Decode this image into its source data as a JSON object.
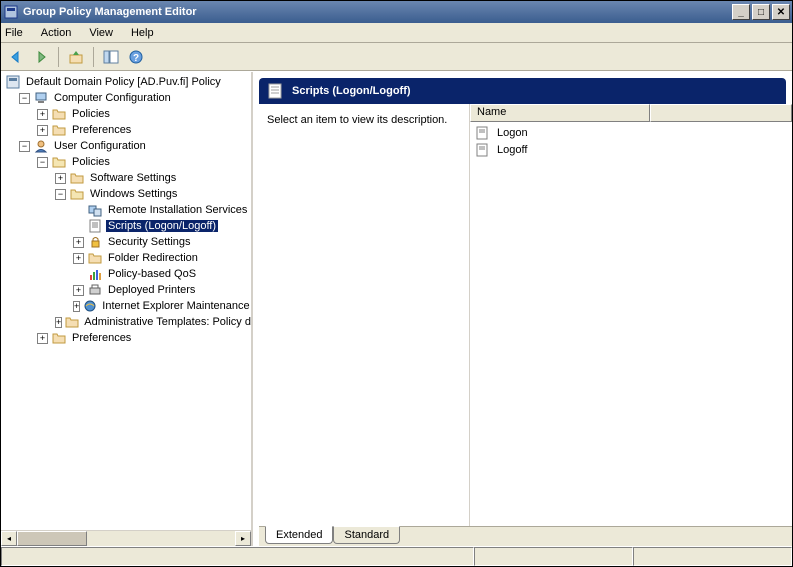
{
  "window": {
    "title": "Group Policy Management Editor"
  },
  "menu": {
    "file": "File",
    "action": "Action",
    "view": "View",
    "help": "Help"
  },
  "tree": {
    "root": "Default Domain Policy [AD.Puv.fi] Policy",
    "computer_config": "Computer Configuration",
    "cc_policies": "Policies",
    "cc_preferences": "Preferences",
    "user_config": "User Configuration",
    "uc_policies": "Policies",
    "software_settings": "Software Settings",
    "windows_settings": "Windows Settings",
    "remote_install": "Remote Installation Services",
    "scripts": "Scripts (Logon/Logoff)",
    "security_settings": "Security Settings",
    "folder_redirection": "Folder Redirection",
    "policy_qos": "Policy-based QoS",
    "deployed_printers": "Deployed Printers",
    "ie_maintenance": "Internet Explorer Maintenance",
    "admin_templates": "Administrative Templates: Policy definitions",
    "uc_preferences": "Preferences"
  },
  "details": {
    "header": "Scripts (Logon/Logoff)",
    "description_prompt": "Select an item to view its description.",
    "columns": {
      "name": "Name"
    },
    "items": [
      {
        "label": "Logon"
      },
      {
        "label": "Logoff"
      }
    ],
    "tabs": {
      "extended": "Extended",
      "standard": "Standard"
    }
  }
}
